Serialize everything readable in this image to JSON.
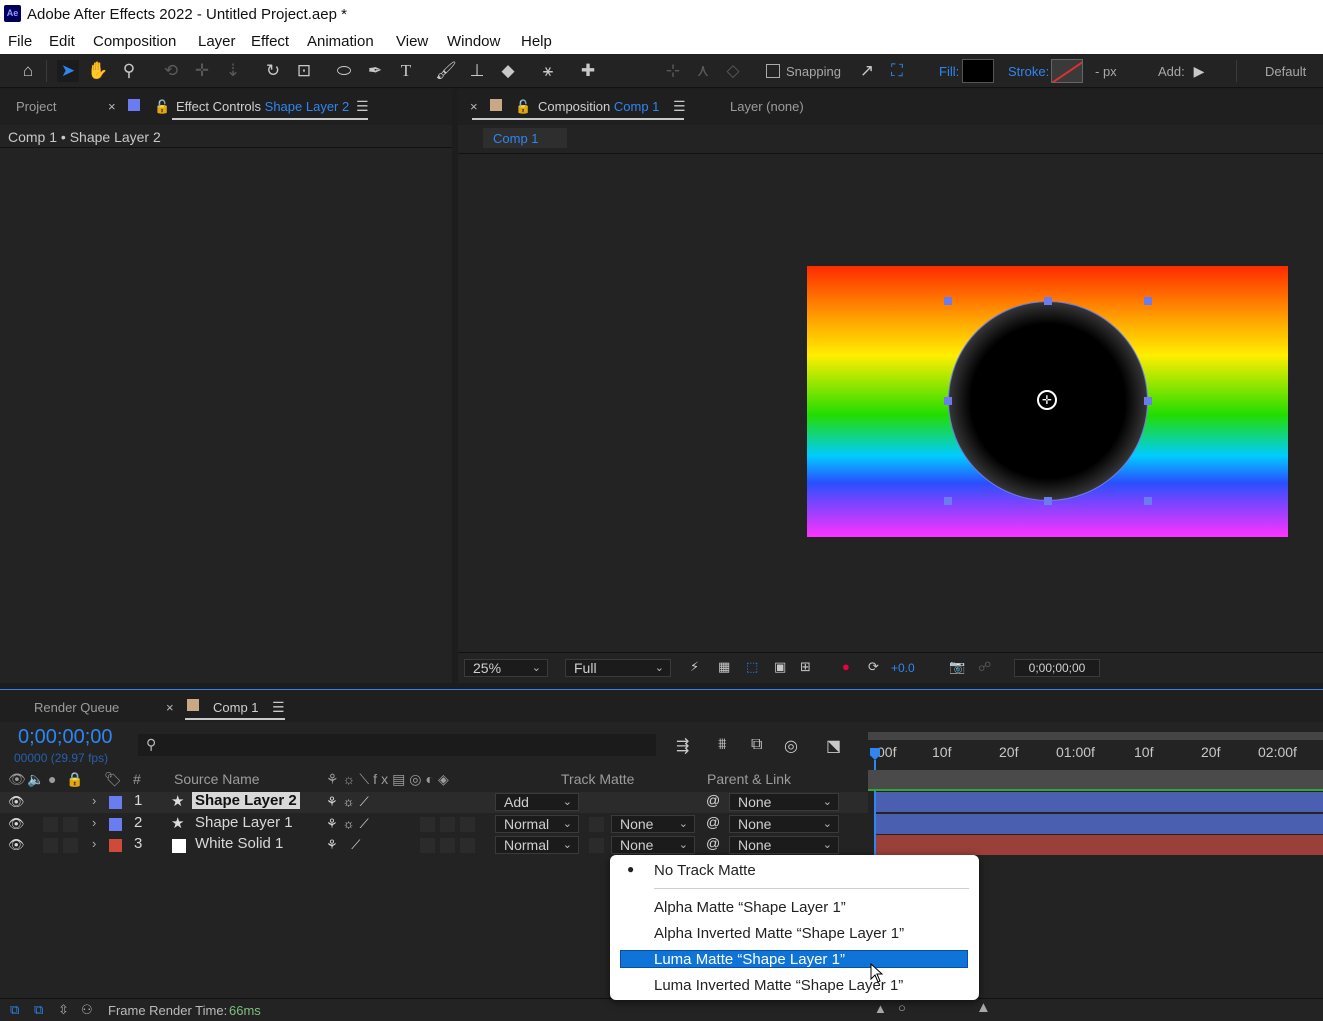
{
  "window": {
    "title": "Adobe After Effects 2022 - Untitled Project.aep *",
    "app_icon": "Ae"
  },
  "menu": [
    "File",
    "Edit",
    "Composition",
    "Layer",
    "Effect",
    "Animation",
    "View",
    "Window",
    "Help"
  ],
  "toolbar": {
    "snapping_label": "Snapping",
    "fill_label": "Fill:",
    "stroke_label": "Stroke:",
    "stroke_units": "- px",
    "add_label": "Add:",
    "workspace": "Default"
  },
  "left_panel": {
    "tab_project": "Project",
    "tab_effect_prefix": "Effect Controls",
    "tab_effect_layer": "Shape Layer 2",
    "breadcrumb": "Comp 1 • Shape Layer 2"
  },
  "comp_panel": {
    "tab_prefix": "Composition",
    "tab_comp": "Comp 1",
    "tab_layer": "Layer (none)",
    "comp_chip": "Comp 1",
    "zoom": "25%",
    "resolution": "Full",
    "exposure": "+0.0",
    "timecode": "0;00;00;00"
  },
  "timeline": {
    "tab_render_queue": "Render Queue",
    "tab_comp": "Comp 1",
    "timecode": "0;00;00;00",
    "frame_info": "00000 (29.97 fps)",
    "search_placeholder": "",
    "col_number": "#",
    "col_source": "Source Name",
    "col_trackmatte": "Track Matte",
    "col_parent": "Parent & Link",
    "ruler": [
      "00f",
      "10f",
      "20f",
      "01:00f",
      "10f",
      "20f",
      "02:00f"
    ],
    "layers": [
      {
        "num": "1",
        "name": "Shape Layer 2",
        "mode": "Add",
        "matte": "",
        "parent": "None",
        "label_color": "#6b7cf0",
        "bar_color": "#4a5fb0"
      },
      {
        "num": "2",
        "name": "Shape Layer 1",
        "mode": "Normal",
        "matte": "None",
        "parent": "None",
        "label_color": "#6b7cf0",
        "bar_color": "#4a5fb0"
      },
      {
        "num": "3",
        "name": "White Solid 1",
        "mode": "Normal",
        "matte": "None",
        "parent": "None",
        "label_color": "#d04a3a",
        "bar_color": "#9a3f3a"
      }
    ],
    "status_label": "Frame Render Time:",
    "status_value": "66ms"
  },
  "track_matte_menu": {
    "items": [
      "No Track Matte",
      "Alpha Matte “Shape Layer 1”",
      "Alpha Inverted Matte “Shape Layer 1”",
      "Luma Matte “Shape Layer 1”",
      "Luma Inverted Matte “Shape Layer 1”"
    ],
    "selected_index": 0,
    "highlighted_index": 3
  },
  "colors": {
    "accent": "#2f86f0",
    "panel_bg": "#232323",
    "highlight": "#0f74d8"
  }
}
